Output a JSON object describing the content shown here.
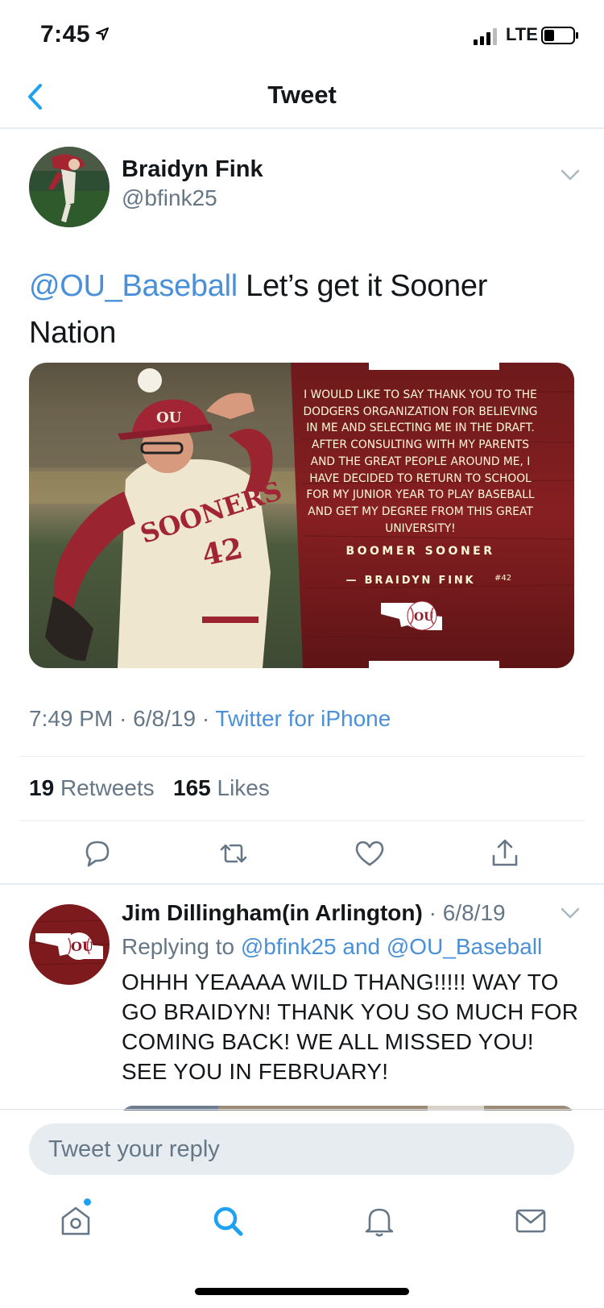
{
  "status_bar": {
    "time": "7:45",
    "carrier": "LTE",
    "icons": [
      "location-arrow-icon",
      "signal-icon",
      "battery-icon"
    ]
  },
  "nav": {
    "title": "Tweet",
    "back_icon": "chevron-left-icon"
  },
  "tweet": {
    "author_name": "Braidyn Fink",
    "author_handle": "@bfink25",
    "text_mention": "@OU_Baseball",
    "text_body": " Let’s get it Sooner Nation",
    "image": {
      "jersey_text": "SOONERS",
      "jersey_number": "42",
      "cap_logo": "OU",
      "statement": "I WOULD LIKE TO SAY THANK YOU TO THE DODGERS ORGANIZATION FOR BELIEVING IN ME AND SELECTING ME IN THE DRAFT. AFTER CONSULTING WITH MY PARENTS AND THE GREAT PEOPLE AROUND ME, I HAVE DECIDED TO RETURN TO SCHOOL FOR MY JUNIOR YEAR TO PLAY BASEBALL AND GET MY DEGREE FROM THIS GREAT UNIVERSITY!",
      "closing": "BOOMER SOONER",
      "signature": "— BRAIDYN FINK",
      "signature_number": "#42",
      "logo_text": "OU"
    },
    "time": "7:49 PM",
    "date": "6/8/19",
    "source": "Twitter for iPhone",
    "separator": "·",
    "retweets_count": "19",
    "retweets_label": "Retweets",
    "likes_count": "165",
    "likes_label": "Likes",
    "actions": [
      "reply-icon",
      "retweet-icon",
      "like-icon",
      "share-icon"
    ]
  },
  "reply": {
    "author_name": "Jim Dillingham(in Arlington)",
    "date": "6/8/19",
    "replying_to_label": "Replying to",
    "replying_to_mentions": "@bfink25 and @OU_Baseball",
    "text": "OHHH YEAAAA WILD THANG!!!!! WAY TO GO  BRAIDYN!  THANK YOU SO MUCH FOR COMING BACK!   WE ALL MISSED YOU!   SEE YOU IN FEBRUARY!",
    "avatar_logo_text": "OU"
  },
  "compose": {
    "placeholder": "Tweet your reply"
  },
  "tabs": [
    "home-icon",
    "search-icon",
    "notifications-icon",
    "messages-icon"
  ],
  "colors": {
    "accent": "#1da1f2",
    "link": "#4a90d9",
    "crimson": "#841617",
    "cream": "#fdf9d8"
  }
}
